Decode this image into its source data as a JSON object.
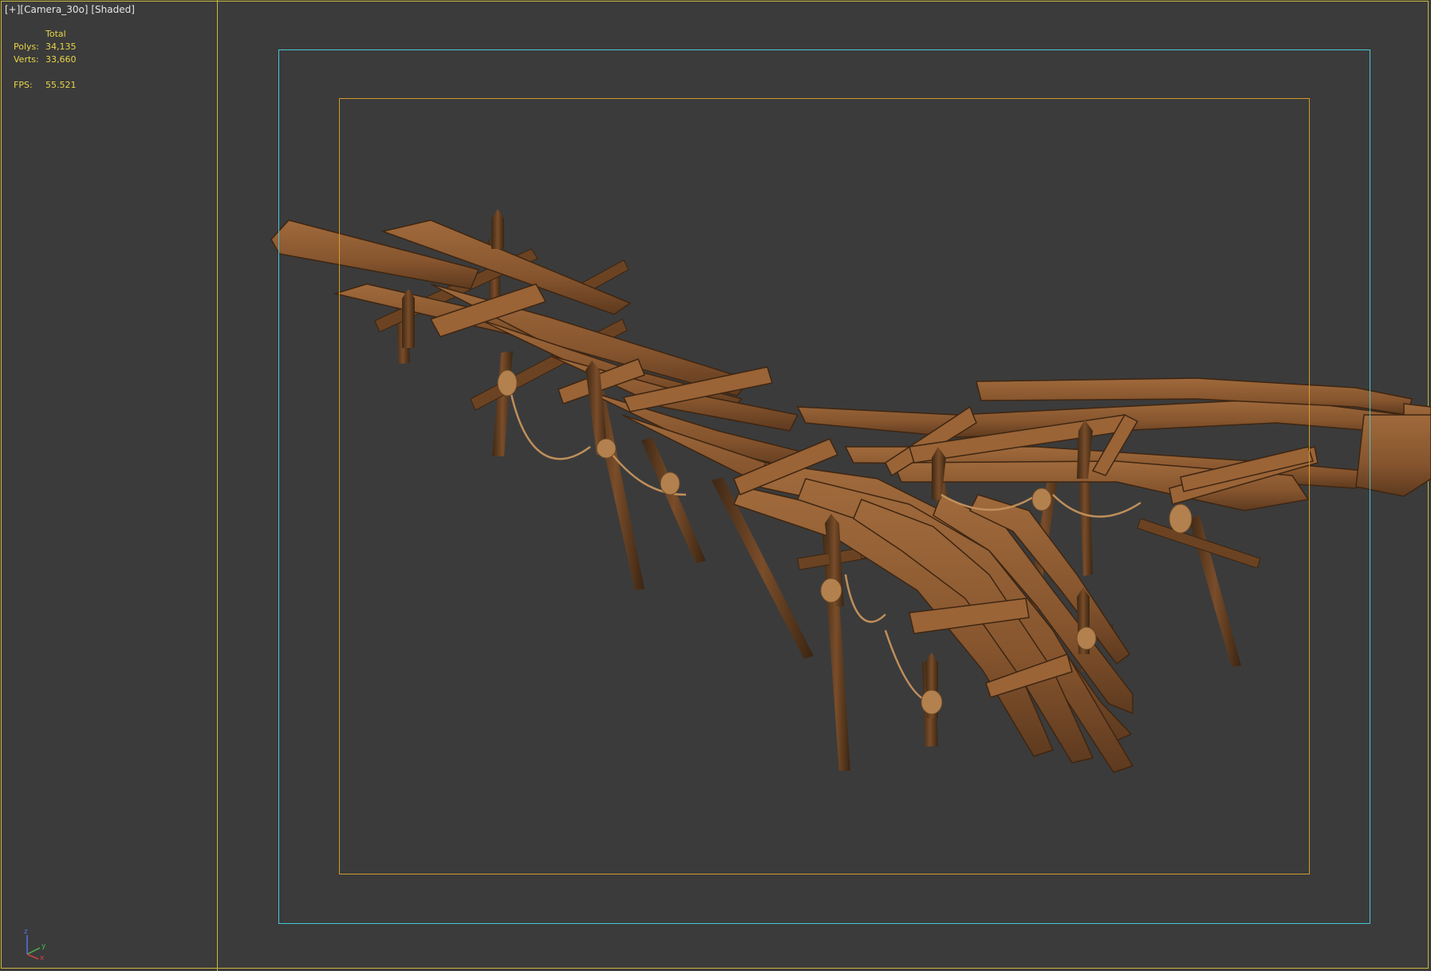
{
  "viewport": {
    "label_plus": "[+]",
    "label_camera": "[Camera_30o]",
    "label_shading": "[Shaded]"
  },
  "stats": {
    "header": "Total",
    "polys_label": "Polys:",
    "polys_value": "34,135",
    "verts_label": "Verts:",
    "verts_value": "33,660",
    "fps_label": "FPS:",
    "fps_value": "55.521"
  },
  "gizmo": {
    "z": "z",
    "y": "y",
    "x": "x"
  },
  "colors": {
    "background": "#3b3b3b",
    "viewport_border": "#c9b83a",
    "safe_frame": "#46c6d6",
    "action_frame": "#d29a2c",
    "stats_text": "#e8d548",
    "wood": "#8a5a33"
  }
}
